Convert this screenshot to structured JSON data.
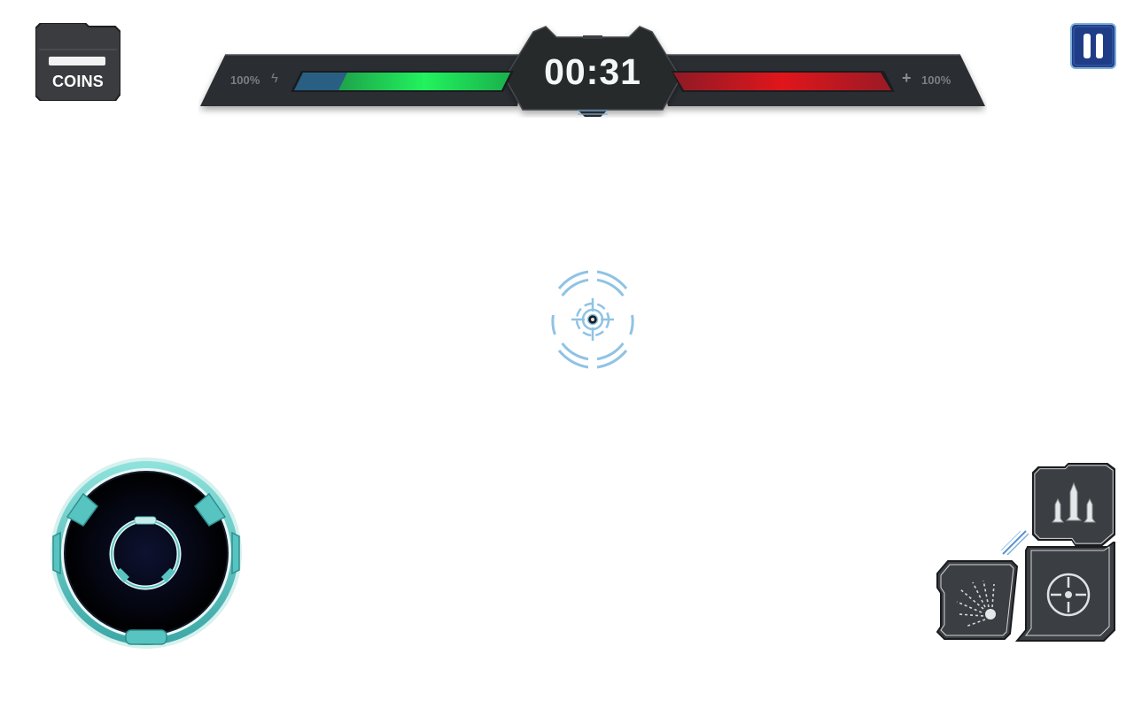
{
  "coins": {
    "label": "COINS"
  },
  "hud": {
    "timer": "00:31",
    "player": {
      "energy_label": "100%",
      "energy_icon": "lightning-icon",
      "health_fraction": 1.0,
      "bar_color": "#1ee85a"
    },
    "enemy": {
      "health_label": "100%",
      "health_icon": "plus-icon",
      "health_fraction": 1.0,
      "bar_color": "#e0161b"
    }
  },
  "controls": {
    "pause_icon": "pause-icon",
    "crosshair_icon": "crosshair-icon",
    "joystick": "virtual-joystick",
    "actions": [
      {
        "name": "missiles-button",
        "icon": "missiles-icon"
      },
      {
        "name": "target-button",
        "icon": "target-icon"
      },
      {
        "name": "scatter-button",
        "icon": "scatter-shot-icon"
      }
    ]
  },
  "colors": {
    "panel_dark": "#2e3033",
    "accent_teal": "#5ec9c6",
    "crosshair_blue": "#8fc3e4",
    "pause_blue": "#1f3d86"
  }
}
